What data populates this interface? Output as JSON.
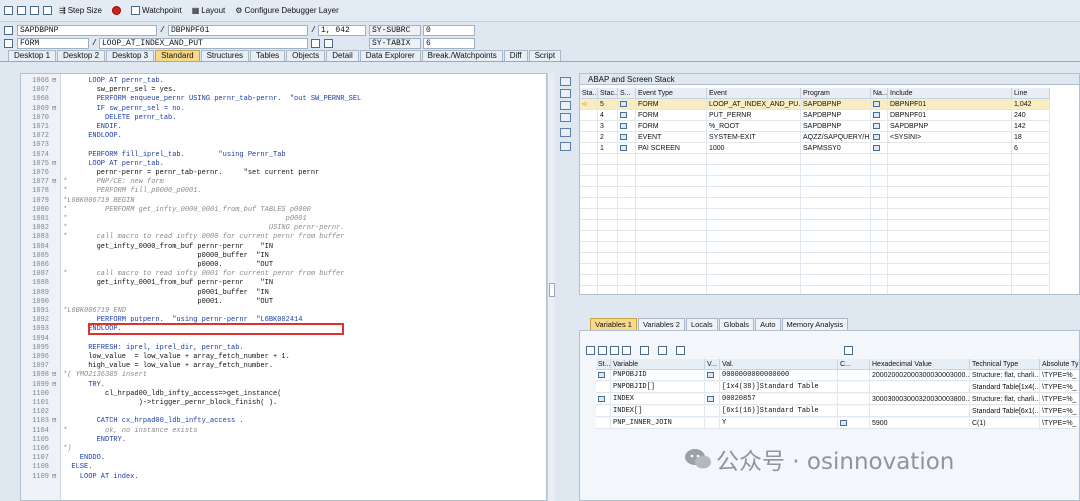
{
  "toolbar": {
    "step_size": "Step Size",
    "watchpoint": "Watchpoint",
    "layout": "Layout",
    "configure": "Configure Debugger Layer"
  },
  "header": {
    "program": "SAPDBPNP",
    "include": "DBPNPF01",
    "line": "1, 042",
    "subrc_label": "SY-SUBRC",
    "subrc_value": "0",
    "event_type": "FORM",
    "event_name": "LOOP_AT_INDEX_AND_PUT",
    "tabix_label": "SY-TABIX",
    "tabix_value": "6"
  },
  "tabs": [
    "Desktop 1",
    "Desktop 2",
    "Desktop 3",
    "Standard",
    "Structures",
    "Tables",
    "Objects",
    "Detail",
    "Data Explorer",
    "Break./Watchpoints",
    "Diff",
    "Script"
  ],
  "active_tab": "Standard",
  "code_lines": [
    {
      "n": "1066",
      "f": "⊟",
      "t": "      LOOP AT pernr_tab.",
      "c": "kw"
    },
    {
      "n": "1067",
      "f": "",
      "t": "        sw_pernr_sel = yes.",
      "c": ""
    },
    {
      "n": "1068",
      "f": "",
      "t": "        PERFORM enqueue_pernr USING pernr_tab-pernr.  \"out SW_PERNR_SEL",
      "c": "kw"
    },
    {
      "n": "1069",
      "f": "⊟",
      "t": "        IF sw_pernr_sel = no.",
      "c": "kw"
    },
    {
      "n": "1070",
      "f": "",
      "t": "          DELETE pernr_tab.",
      "c": "kw"
    },
    {
      "n": "1071",
      "f": "",
      "t": "        ENDIF.",
      "c": "kw"
    },
    {
      "n": "1072",
      "f": "",
      "t": "      ENDLOOP.",
      "c": "kw"
    },
    {
      "n": "1073",
      "f": "",
      "t": "",
      "c": ""
    },
    {
      "n": "1074",
      "f": "",
      "t": "      PERFORM fill_iprel_tab.        \"using Pernr_Tab",
      "c": "kw"
    },
    {
      "n": "1075",
      "f": "⊟",
      "t": "      LOOP AT pernr_tab.",
      "c": "kw"
    },
    {
      "n": "1076",
      "f": "",
      "t": "        pernr-pernr = pernr_tab-pernr.     \"set current pernr",
      "c": ""
    },
    {
      "n": "1077",
      "f": "⊟",
      "t": "*       PNP/CE: new form",
      "c": "cm"
    },
    {
      "n": "1078",
      "f": "",
      "t": "*       PERFORM fill_p0000_p0001.",
      "c": "cm"
    },
    {
      "n": "1079",
      "f": "",
      "t": "*L6BK006719 BEGIN",
      "c": "cm"
    },
    {
      "n": "1080",
      "f": "",
      "t": "*         PERFORM get_infty_0000_0001_from_buf TABLES p0000",
      "c": "cm"
    },
    {
      "n": "1081",
      "f": "",
      "t": "*                                                    p0001",
      "c": "cm"
    },
    {
      "n": "1082",
      "f": "",
      "t": "*                                                USING pernr-pernr.",
      "c": "cm"
    },
    {
      "n": "1083",
      "f": "",
      "t": "*       call macro to read infty 0000 for current pernr from buffer",
      "c": "cm"
    },
    {
      "n": "1084",
      "f": "",
      "t": "        get_infty_0000_from_buf pernr-pernr    \"IN",
      "c": ""
    },
    {
      "n": "1085",
      "f": "",
      "t": "                                p0000_buffer  \"IN",
      "c": ""
    },
    {
      "n": "1086",
      "f": "",
      "t": "                                p0000.        \"OUT",
      "c": ""
    },
    {
      "n": "1087",
      "f": "",
      "t": "*       call macro to read infty 0001 for current pernr from buffer",
      "c": "cm"
    },
    {
      "n": "1088",
      "f": "",
      "t": "        get_infty_0001_from_buf pernr-pernr    \"IN",
      "c": ""
    },
    {
      "n": "1089",
      "f": "",
      "t": "                                p0001_buffer  \"IN",
      "c": ""
    },
    {
      "n": "1090",
      "f": "",
      "t": "                                p0001.        \"OUT",
      "c": ""
    },
    {
      "n": "1091",
      "f": "",
      "t": "*L6BK006719 END",
      "c": "cm"
    },
    {
      "n": "1092",
      "f": "",
      "t": "        PERFORM putpern.  \"using pernr-pernr  \"L6BK002414",
      "c": "kw"
    },
    {
      "n": "1093",
      "f": "",
      "t": "      ENDLOOP.",
      "c": "kw"
    },
    {
      "n": "1094",
      "f": "",
      "t": "",
      "c": ""
    },
    {
      "n": "1095",
      "f": "",
      "t": "      REFRESH: iprel, iprel_dir, pernr_tab.",
      "c": "kw"
    },
    {
      "n": "1096",
      "f": "",
      "t": "      low_value  = low_value + array_fetch_number + 1.",
      "c": ""
    },
    {
      "n": "1097",
      "f": "",
      "t": "      high_value = low_value + array_fetch_number.",
      "c": ""
    },
    {
      "n": "1098",
      "f": "⊟",
      "t": "*( YMO2136385 insert",
      "c": "cm"
    },
    {
      "n": "1099",
      "f": "⊟",
      "t": "      TRY.",
      "c": "kw"
    },
    {
      "n": "1100",
      "f": "",
      "t": "          cl_hrpad00_ldb_infty_access=>get_instance(",
      "c": ""
    },
    {
      "n": "1101",
      "f": "",
      "t": "                  )->trigger_pernr_block_finish( ).",
      "c": ""
    },
    {
      "n": "1102",
      "f": "",
      "t": "",
      "c": ""
    },
    {
      "n": "1103",
      "f": "⊟",
      "t": "        CATCH cx_hrpad00_ldb_infty_access .",
      "c": "kw"
    },
    {
      "n": "1104",
      "f": "",
      "t": "*         ok, no instance exists",
      "c": "cm"
    },
    {
      "n": "1105",
      "f": "",
      "t": "        ENDTRY.",
      "c": "kw"
    },
    {
      "n": "1106",
      "f": "",
      "t": "*)",
      "c": "cm"
    },
    {
      "n": "1107",
      "f": "",
      "t": "    ENDDO.",
      "c": "kw"
    },
    {
      "n": "1108",
      "f": "",
      "t": "  ELSE.",
      "c": "kw"
    },
    {
      "n": "1109",
      "f": "⊟",
      "t": "    LOOP AT index.",
      "c": "kw"
    }
  ],
  "stack": {
    "title": "ABAP and Screen Stack",
    "headers": [
      "Sta...",
      "Stac...",
      "S...",
      "Event Type",
      "Event",
      "Program",
      "Na...",
      "Include",
      "Line"
    ],
    "rows": [
      {
        "sta": "➪",
        "stac": "5",
        "type": "FORM",
        "event": "LOOP_AT_INDEX_AND_PU...",
        "program": "SAPDBPNP",
        "include": "DBPNPF01",
        "line": "1,042"
      },
      {
        "sta": "",
        "stac": "4",
        "type": "FORM",
        "event": "PUT_PERNR",
        "program": "SAPDBPNP",
        "include": "DBPNPF01",
        "line": "240"
      },
      {
        "sta": "",
        "stac": "3",
        "type": "FORM",
        "event": "%_ROOT",
        "program": "SAPDBPNP",
        "include": "SAPDBPNP",
        "line": "142"
      },
      {
        "sta": "",
        "stac": "2",
        "type": "EVENT",
        "event": "SYSTEM-EXIT",
        "program": "AQZZ/SAPQUERY/H2BIRT...",
        "include": "<SYSINI>",
        "line": "18"
      },
      {
        "sta": "",
        "stac": "1",
        "type": "PAI SCREEN",
        "event": "1000",
        "program": "SAPMSSY0",
        "include": "",
        "line": "6"
      }
    ]
  },
  "var_tabs": [
    "Variables 1",
    "Variables 2",
    "Locals",
    "Globals",
    "Auto",
    "Memory Analysis"
  ],
  "vars": {
    "headers": [
      "St...",
      "Variable",
      "V...",
      "Val.",
      "C...",
      "Hexadecimal Value",
      "Technical Type",
      "Absolute Ty"
    ],
    "rows": [
      {
        "var": "PNPOBJID",
        "val": "0000000000000000",
        "hex": "200020002000300030003000...",
        "tech": "Structure: flat, charli...",
        "abs": "\\TYPE=%_"
      },
      {
        "var": "PNPOBJID[]",
        "val": "[1x4(38)]Standard Table",
        "hex": "",
        "tech": "Standard Table[1x4(...",
        "abs": "\\TYPE=%_"
      },
      {
        "var": "INDEX",
        "val": "00020857",
        "hex": "300030003000320030003800...",
        "tech": "Structure: flat, charli...",
        "abs": "\\TYPE=%_"
      },
      {
        "var": "INDEX[]",
        "val": "[6x1(16)]Standard Table",
        "hex": "",
        "tech": "Standard Table[6x1(...",
        "abs": "\\TYPE=%_"
      },
      {
        "var": "PNP_INNER_JOIN",
        "val": "Y",
        "hex": "5900",
        "tech": "C(1)",
        "abs": "\\TYPE=%_"
      }
    ]
  },
  "watermark": "公众号 · osinnovation"
}
